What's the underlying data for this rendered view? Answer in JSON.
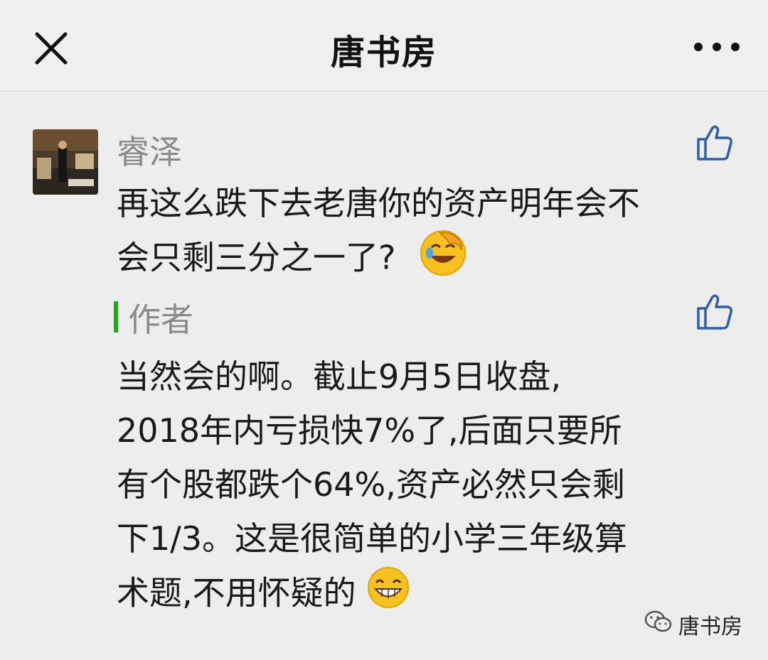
{
  "header": {
    "title": "唐书房",
    "close_icon": "close-icon",
    "more_icon": "more-icon"
  },
  "comment": {
    "author": "睿泽",
    "text_line1": "再这么跌下去老唐你的资产明年会不",
    "text_line2": "会只剩三分之一了?",
    "emoji": "facepalm-laugh-emoji",
    "like_icon": "thumbs-up-icon"
  },
  "reply": {
    "author": "作者",
    "lines": [
      "当然会的啊。截止9月5日收盘,",
      "2018年内亏损快7%了,后面只要所",
      "有个股都跌个64%,资产必然只会剩",
      "下1/3。这是很简单的小学三年级算",
      "术题,不用怀疑的"
    ],
    "emoji": "grin-emoji",
    "like_icon": "thumbs-up-icon",
    "accent_color": "#1aad19"
  },
  "footer": {
    "brand": "唐书房",
    "icon": "wechat-icon"
  }
}
